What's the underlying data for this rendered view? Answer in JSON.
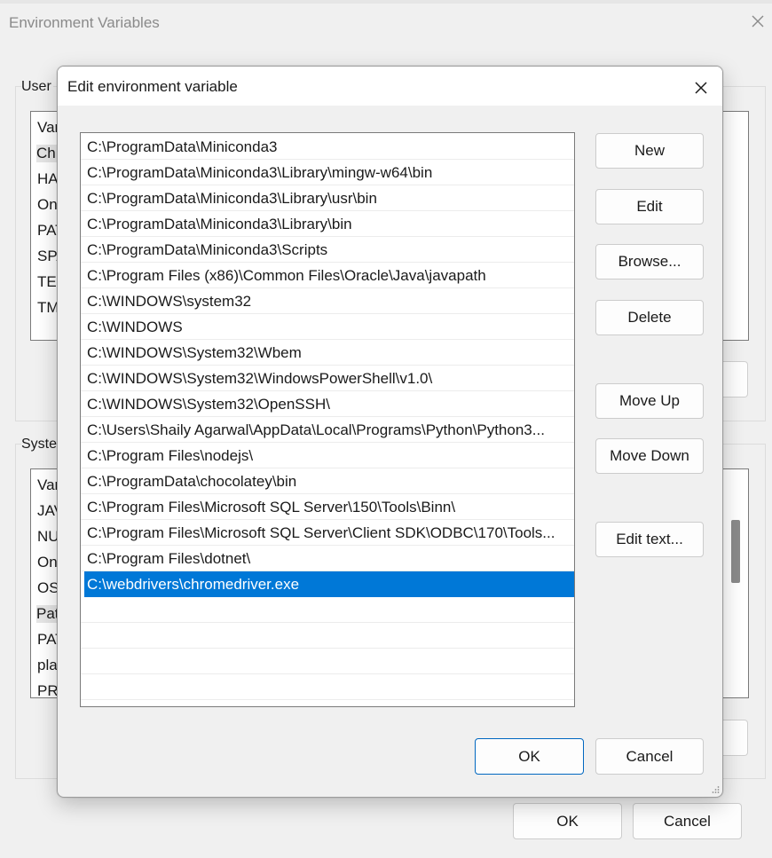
{
  "background_window": {
    "title": "Environment Variables",
    "user_group_label": "User",
    "system_group_label": "Syste",
    "user_rows": [
      "Var",
      "Ch",
      "HA",
      "On",
      "PAT",
      "SPA",
      "TEI",
      "TM"
    ],
    "system_rows": [
      "Var",
      "JAV",
      "NU",
      "On",
      "OS",
      "Pat",
      "PAT",
      "pla",
      "PR"
    ],
    "ok_label": "OK",
    "cancel_label": "Cancel"
  },
  "dialog": {
    "title": "Edit environment variable",
    "paths": [
      "C:\\ProgramData\\Miniconda3",
      "C:\\ProgramData\\Miniconda3\\Library\\mingw-w64\\bin",
      "C:\\ProgramData\\Miniconda3\\Library\\usr\\bin",
      "C:\\ProgramData\\Miniconda3\\Library\\bin",
      "C:\\ProgramData\\Miniconda3\\Scripts",
      "C:\\Program Files (x86)\\Common Files\\Oracle\\Java\\javapath",
      "C:\\WINDOWS\\system32",
      "C:\\WINDOWS",
      "C:\\WINDOWS\\System32\\Wbem",
      "C:\\WINDOWS\\System32\\WindowsPowerShell\\v1.0\\",
      "C:\\WINDOWS\\System32\\OpenSSH\\",
      "C:\\Users\\Shaily Agarwal\\AppData\\Local\\Programs\\Python\\Python3...",
      "C:\\Program Files\\nodejs\\",
      "C:\\ProgramData\\chocolatey\\bin",
      "C:\\Program Files\\Microsoft SQL Server\\150\\Tools\\Binn\\",
      "C:\\Program Files\\Microsoft SQL Server\\Client SDK\\ODBC\\170\\Tools...",
      "C:\\Program Files\\dotnet\\",
      "C:\\webdrivers\\chromedriver.exe"
    ],
    "selected_index": 17,
    "buttons": {
      "new": "New",
      "edit": "Edit",
      "browse": "Browse...",
      "delete": "Delete",
      "move_up": "Move Up",
      "move_down": "Move Down",
      "edit_text": "Edit text...",
      "ok": "OK",
      "cancel": "Cancel"
    }
  },
  "colors": {
    "selection": "#0078d7",
    "ok_border": "#0067c0",
    "window_bg": "#f0f0f0"
  }
}
